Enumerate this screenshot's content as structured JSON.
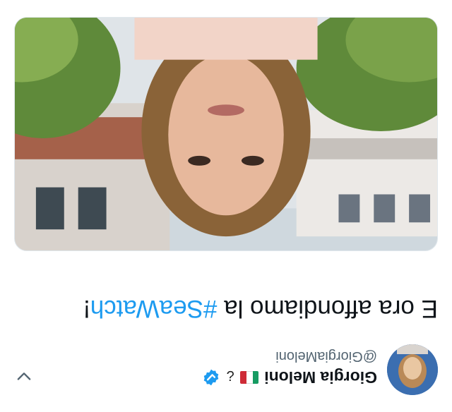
{
  "tweet": {
    "author": {
      "display_name": "Giorgia Meloni",
      "handle": "@GiorgiaMeloni",
      "extra_glyph": "¿",
      "verified": true
    },
    "text_prefix": "E ora affondiamo la ",
    "hashtag": "#SeaWatch",
    "text_suffix": "!"
  },
  "icons": {
    "avatar": "avatar-photo",
    "flag": "italy-flag-emoji",
    "verified": "verified-badge-icon",
    "more": "chevron-down-icon"
  },
  "colors": {
    "text": "#0f1419",
    "secondary": "#536471",
    "link": "#1d9bf0",
    "verified": "#1d9bf0"
  }
}
